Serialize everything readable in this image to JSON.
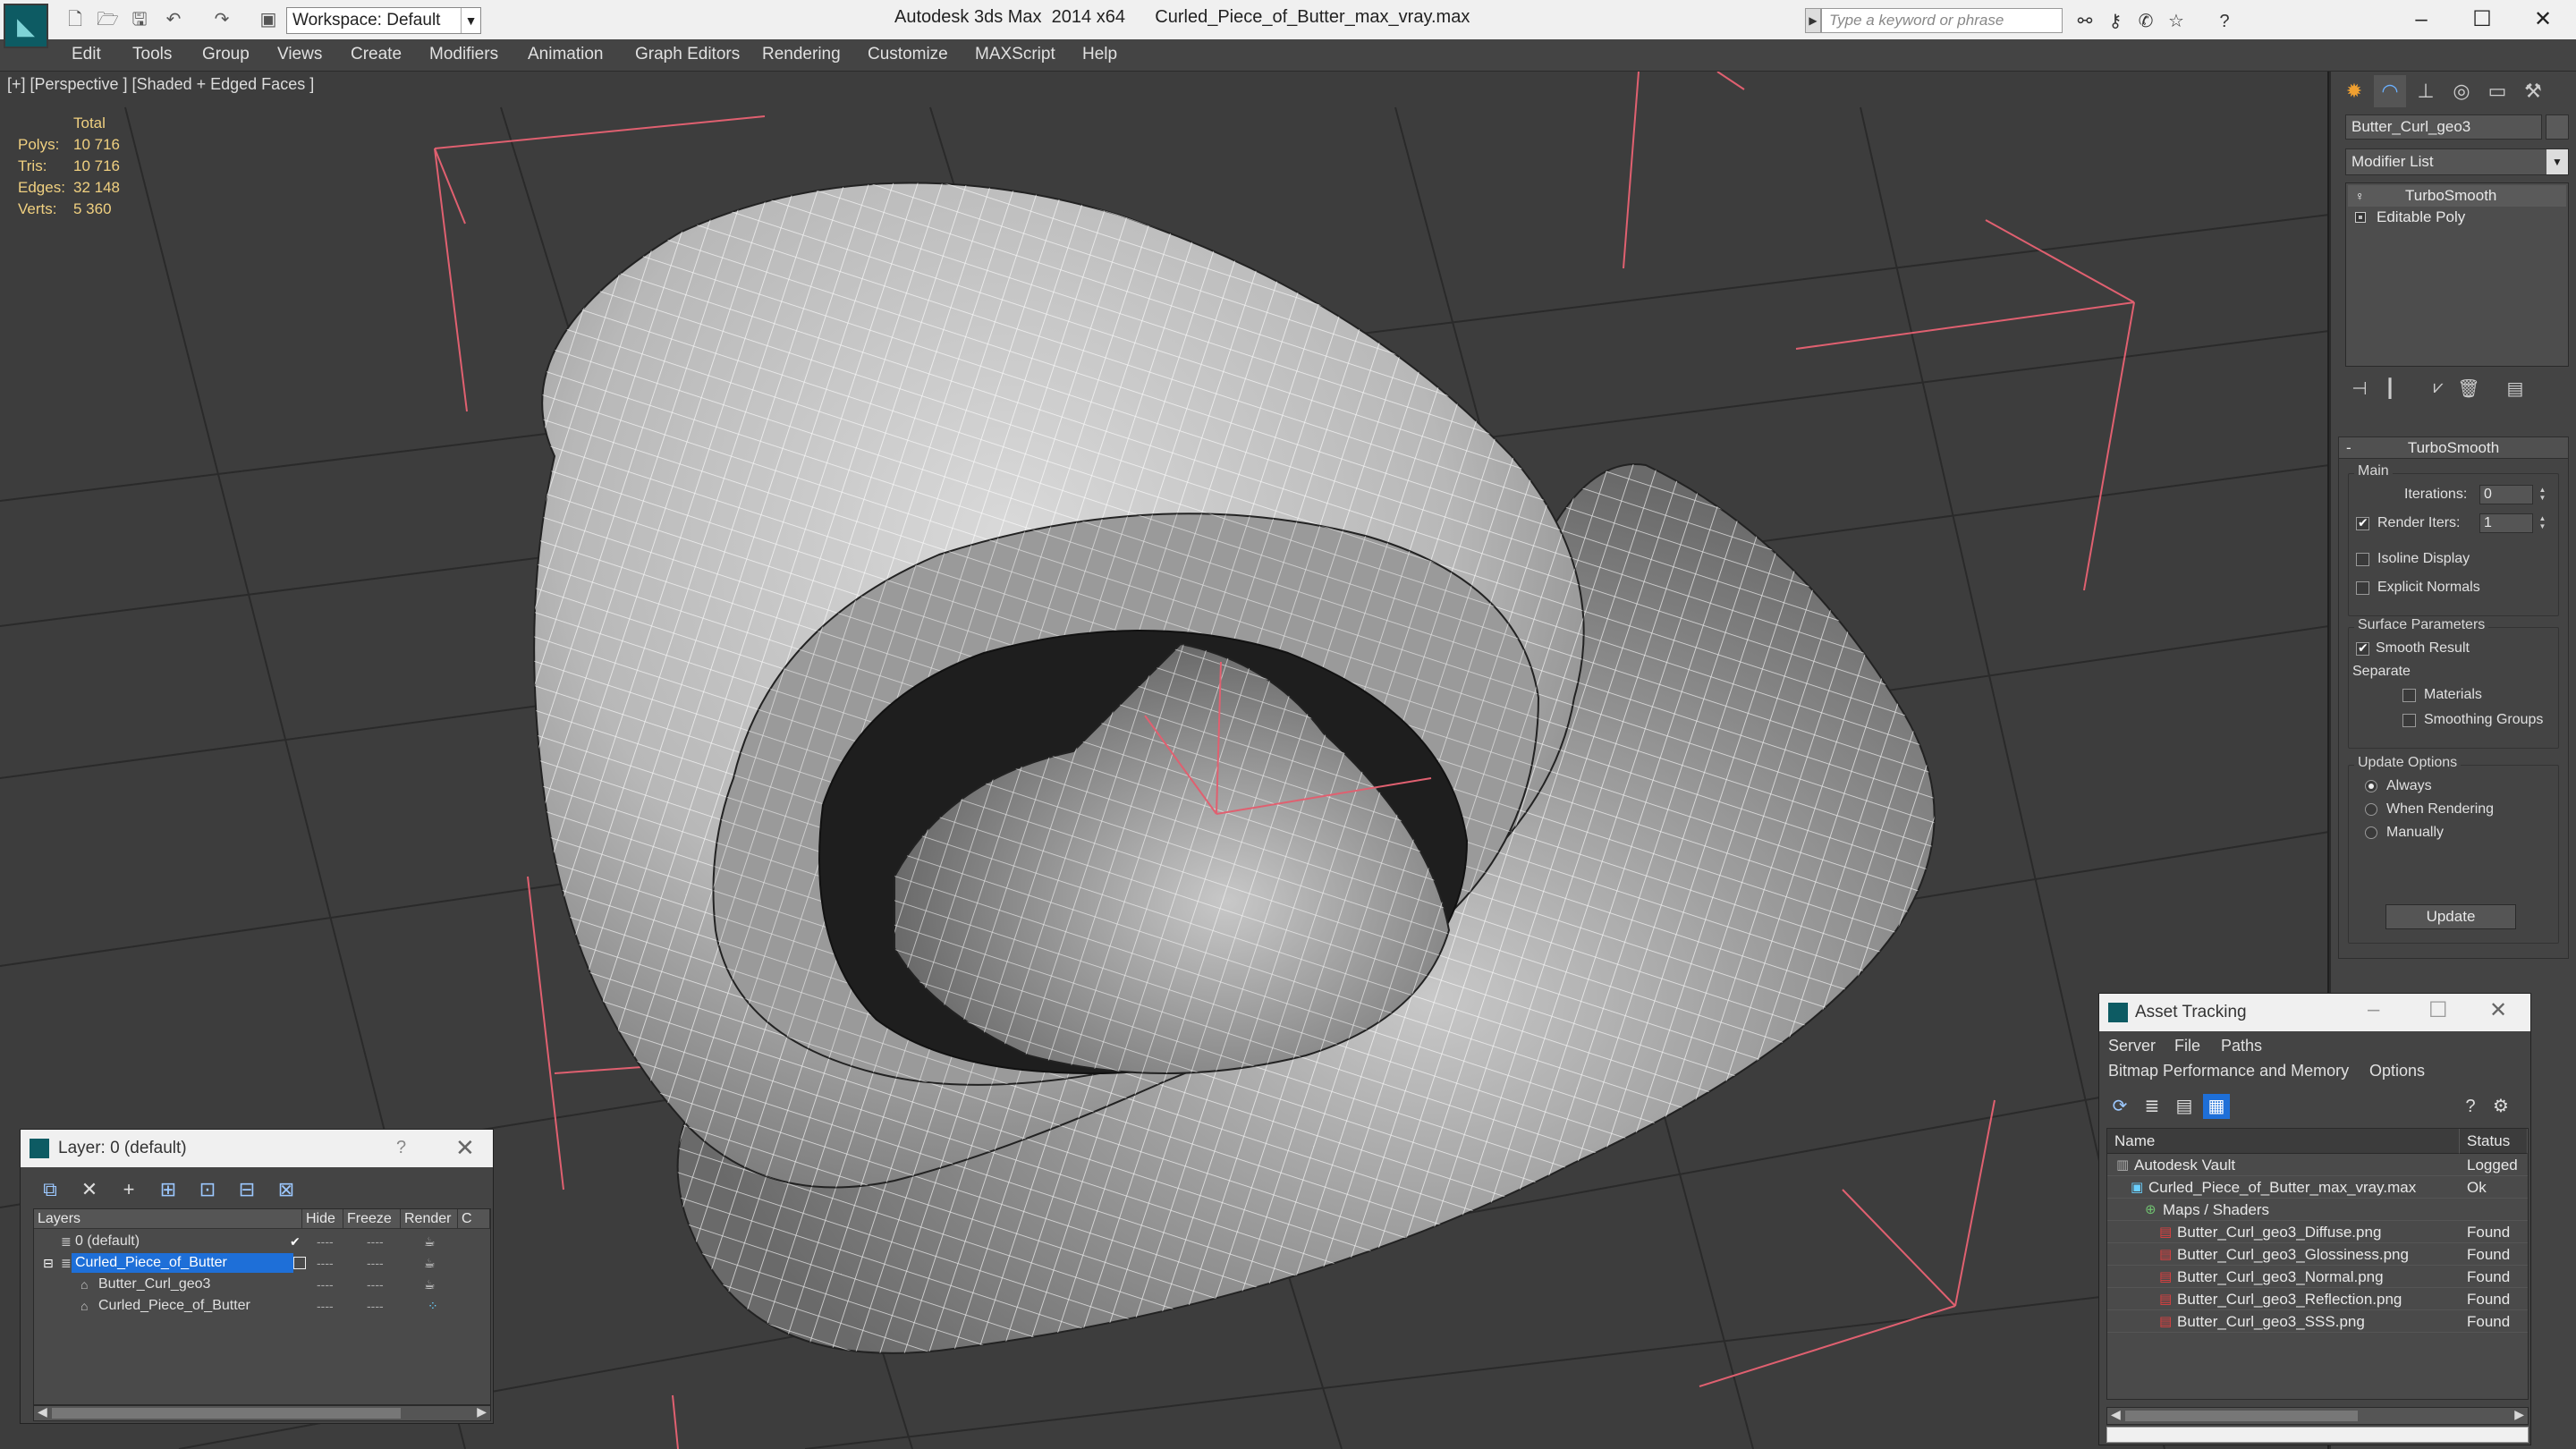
{
  "app": {
    "title": "Autodesk 3ds Max  2014 x64",
    "file": "Curled_Piece_of_Butter_max_vray.max",
    "workspace": "Workspace: Default",
    "search_placeholder": "Type a keyword or phrase"
  },
  "menu": [
    "Edit",
    "Tools",
    "Group",
    "Views",
    "Create",
    "Modifiers",
    "Animation",
    "Graph Editors",
    "Rendering",
    "Customize",
    "MAXScript",
    "Help"
  ],
  "viewport": {
    "label": "[+] [Perspective ] [Shaded + Edged Faces ]",
    "stats": {
      "header": "Total",
      "rows": [
        {
          "k": "Polys:",
          "v": "10 716"
        },
        {
          "k": "Tris:",
          "v": "10 716"
        },
        {
          "k": "Edges:",
          "v": "32 148"
        },
        {
          "k": "Verts:",
          "v": "5 360"
        }
      ]
    }
  },
  "command_panel": {
    "object_name": "Butter_Curl_geo3",
    "modifier_list": "Modifier List",
    "stack": [
      "TurboSmooth",
      "Editable Poly"
    ],
    "rollout_title": "TurboSmooth",
    "main_group": "Main",
    "iterations_label": "Iterations:",
    "iterations_value": "0",
    "render_iters_label": "Render Iters:",
    "render_iters_value": "1",
    "isoline": "Isoline Display",
    "explicit_normals": "Explicit Normals",
    "surface_group": "Surface Parameters",
    "smooth_result": "Smooth Result",
    "separate": "Separate",
    "materials": "Materials",
    "smoothing_groups": "Smoothing Groups",
    "update_group": "Update Options",
    "always": "Always",
    "when_rendering": "When Rendering",
    "manually": "Manually",
    "update_button": "Update"
  },
  "layer_window": {
    "title": "Layer: 0 (default)",
    "help": "?",
    "columns": [
      "Layers",
      "Hide",
      "Freeze",
      "Render",
      "C"
    ],
    "rows": [
      {
        "name": "0 (default)",
        "indent": 1
      },
      {
        "name": "Curled_Piece_of_Butter",
        "indent": 1
      },
      {
        "name": "Butter_Curl_geo3",
        "indent": 2
      },
      {
        "name": "Curled_Piece_of_Butter",
        "indent": 2
      }
    ]
  },
  "asset_window": {
    "title": "Asset Tracking",
    "menu_row1": [
      "Server",
      "File",
      "Paths"
    ],
    "menu_row2": [
      "Bitmap Performance and Memory",
      "Options"
    ],
    "columns": [
      "Name",
      "Status"
    ],
    "rows": [
      {
        "name": "Autodesk Vault",
        "status": "Logged",
        "indent": 1,
        "icon": "vault"
      },
      {
        "name": "Curled_Piece_of_Butter_max_vray.max",
        "status": "Ok",
        "indent": 2,
        "icon": "max"
      },
      {
        "name": "Maps / Shaders",
        "status": "",
        "indent": 3,
        "icon": "maps"
      },
      {
        "name": "Butter_Curl_geo3_Diffuse.png",
        "status": "Found",
        "indent": 4,
        "icon": "png"
      },
      {
        "name": "Butter_Curl_geo3_Glossiness.png",
        "status": "Found",
        "indent": 4,
        "icon": "png"
      },
      {
        "name": "Butter_Curl_geo3_Normal.png",
        "status": "Found",
        "indent": 4,
        "icon": "png"
      },
      {
        "name": "Butter_Curl_geo3_Reflection.png",
        "status": "Found",
        "indent": 4,
        "icon": "png"
      },
      {
        "name": "Butter_Curl_geo3_SSS.png",
        "status": "Found",
        "indent": 4,
        "icon": "png"
      }
    ]
  },
  "colors": {
    "stats_text": "#f0d080",
    "selection": "#1e6fd8",
    "bbox_lines": "#e06070"
  }
}
